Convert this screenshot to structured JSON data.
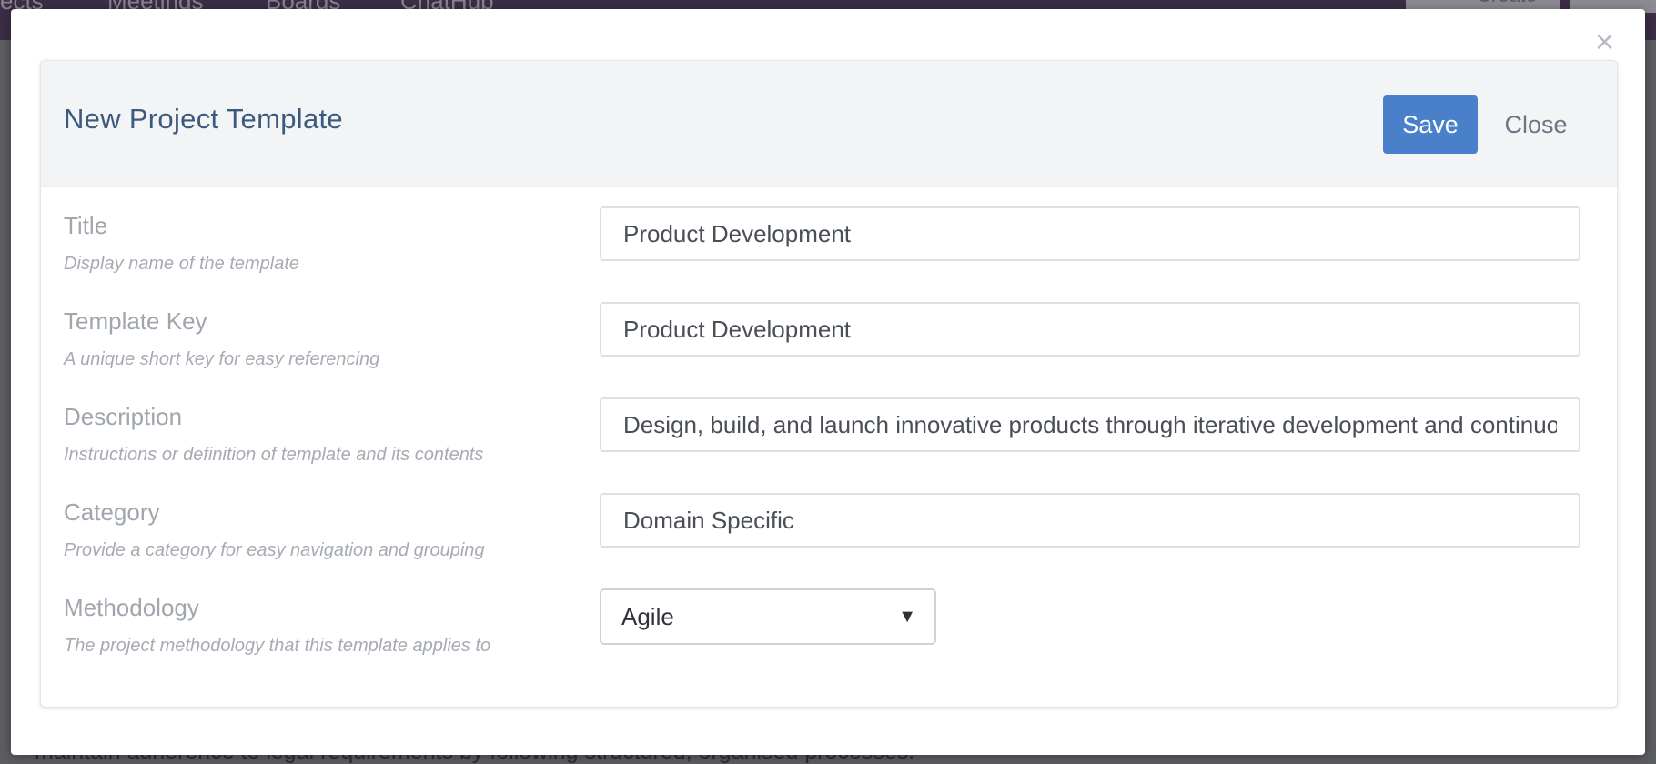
{
  "background": {
    "nav_items": [
      "ects",
      "Meetings",
      "Boards",
      "ChatHub"
    ],
    "create_label": "Create",
    "footer_text": "maintain adherence to legal requirements by following structured, organised processes."
  },
  "modal": {
    "close_icon": "×",
    "title": "New Project Template",
    "save_label": "Save",
    "close_label": "Close",
    "fields": {
      "title": {
        "label": "Title",
        "help": "Display name of the template",
        "value": "Product Development"
      },
      "template_key": {
        "label": "Template Key",
        "help": "A unique short key for easy referencing",
        "value": "Product Development"
      },
      "description": {
        "label": "Description",
        "help": "Instructions or definition of template and its contents",
        "value": "Design, build, and launch innovative products through iterative development and continuous improvement."
      },
      "category": {
        "label": "Category",
        "help": "Provide a category for easy navigation and grouping",
        "value": "Domain Specific"
      },
      "methodology": {
        "label": "Methodology",
        "help": "The project methodology that this template applies to",
        "value": "Agile",
        "arrow": "▼"
      }
    }
  },
  "colors": {
    "accent": "#4a80c9",
    "title": "#3c5a80",
    "label": "#a0a6ae",
    "overlay": "#5d5e62"
  }
}
